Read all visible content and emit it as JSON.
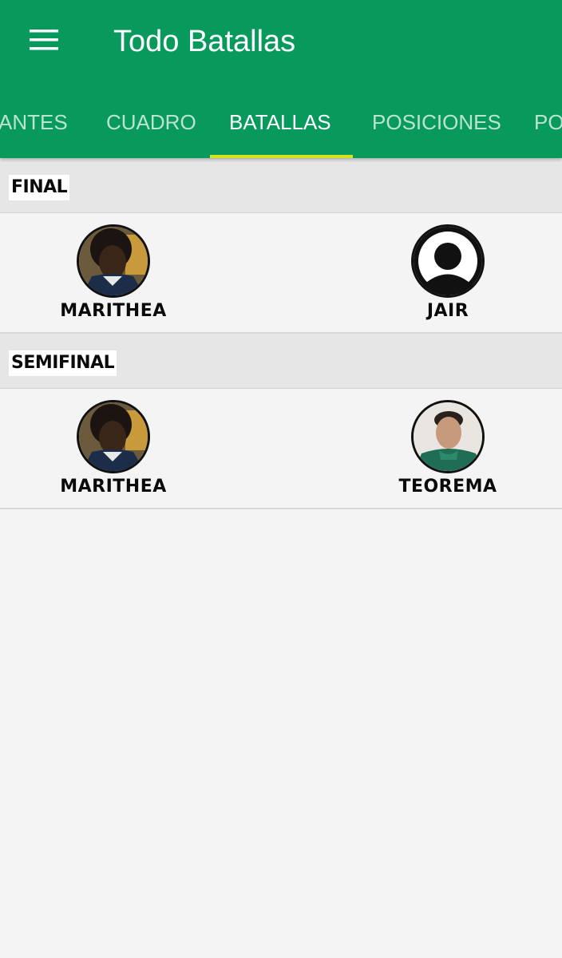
{
  "app": {
    "title": "Todo Batallas",
    "header_color": "#089a5c",
    "indicator_color": "#d3e41f"
  },
  "tabs": [
    {
      "label": "ANTES",
      "active": false
    },
    {
      "label": "CUADRO",
      "active": false
    },
    {
      "label": "BATALLAS",
      "active": true
    },
    {
      "label": "POSICIONES",
      "active": false
    },
    {
      "label": "PO",
      "active": false
    }
  ],
  "sections": [
    {
      "title": "FINAL",
      "battle": {
        "left": {
          "name": "MARITHEA",
          "avatar": "person-photo-icon"
        },
        "right": {
          "name": "JAIR",
          "avatar": "default-user-icon"
        }
      }
    },
    {
      "title": "SEMIFINAL",
      "battle": {
        "left": {
          "name": "MARITHEA",
          "avatar": "person-photo-icon"
        },
        "right": {
          "name": "TEOREMA",
          "avatar": "person-photo-icon"
        }
      }
    }
  ]
}
